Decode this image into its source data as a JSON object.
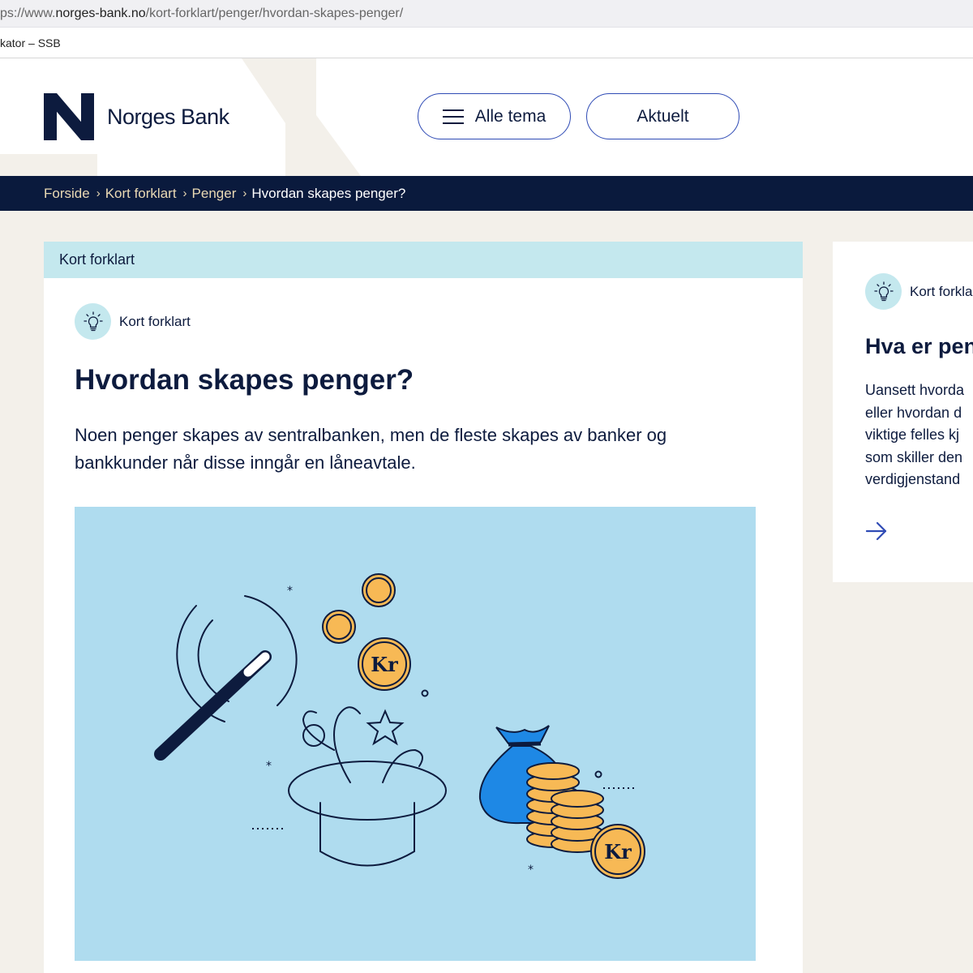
{
  "browser": {
    "url_prefix": "ps://www.",
    "url_host": "norges-bank.no",
    "url_path": "/kort-forklart/penger/hvordan-skapes-penger/",
    "tab_title": "kator – SSB"
  },
  "header": {
    "logo_text": "Norges Bank",
    "menu_label": "Alle tema",
    "news_label": "Aktuelt"
  },
  "breadcrumb": {
    "items": [
      "Forside",
      "Kort forklart",
      "Penger"
    ],
    "current": "Hvordan skapes penger?"
  },
  "article": {
    "band_label": "Kort forklart",
    "category": "Kort forklart",
    "title": "Hvordan skapes penger?",
    "lead": "Noen penger skapes av sentralbanken, men de fleste skapes av banker og bankkunder når disse inngår en låneavtale.",
    "coin_label": "Kr"
  },
  "sidebar_card": {
    "category": "Kort forkla",
    "title": "Hva er pen",
    "body_lines": [
      "Uansett hvorda",
      "eller hvordan d",
      "viktige felles kj",
      "som skiller den",
      "verdigjenstand"
    ]
  },
  "icons": [
    "hamburger-icon",
    "lightbulb-icon",
    "arrow-right-icon",
    "chevron-right-icon",
    "norges-bank-logo-icon"
  ],
  "colors": {
    "navy": "#0a1a3d",
    "accent_blue": "#2f4bb5",
    "band": "#c4e8ee",
    "illustration_bg": "#afdcef",
    "coin": "#f7b955",
    "page_bg": "#f3f0ea"
  }
}
